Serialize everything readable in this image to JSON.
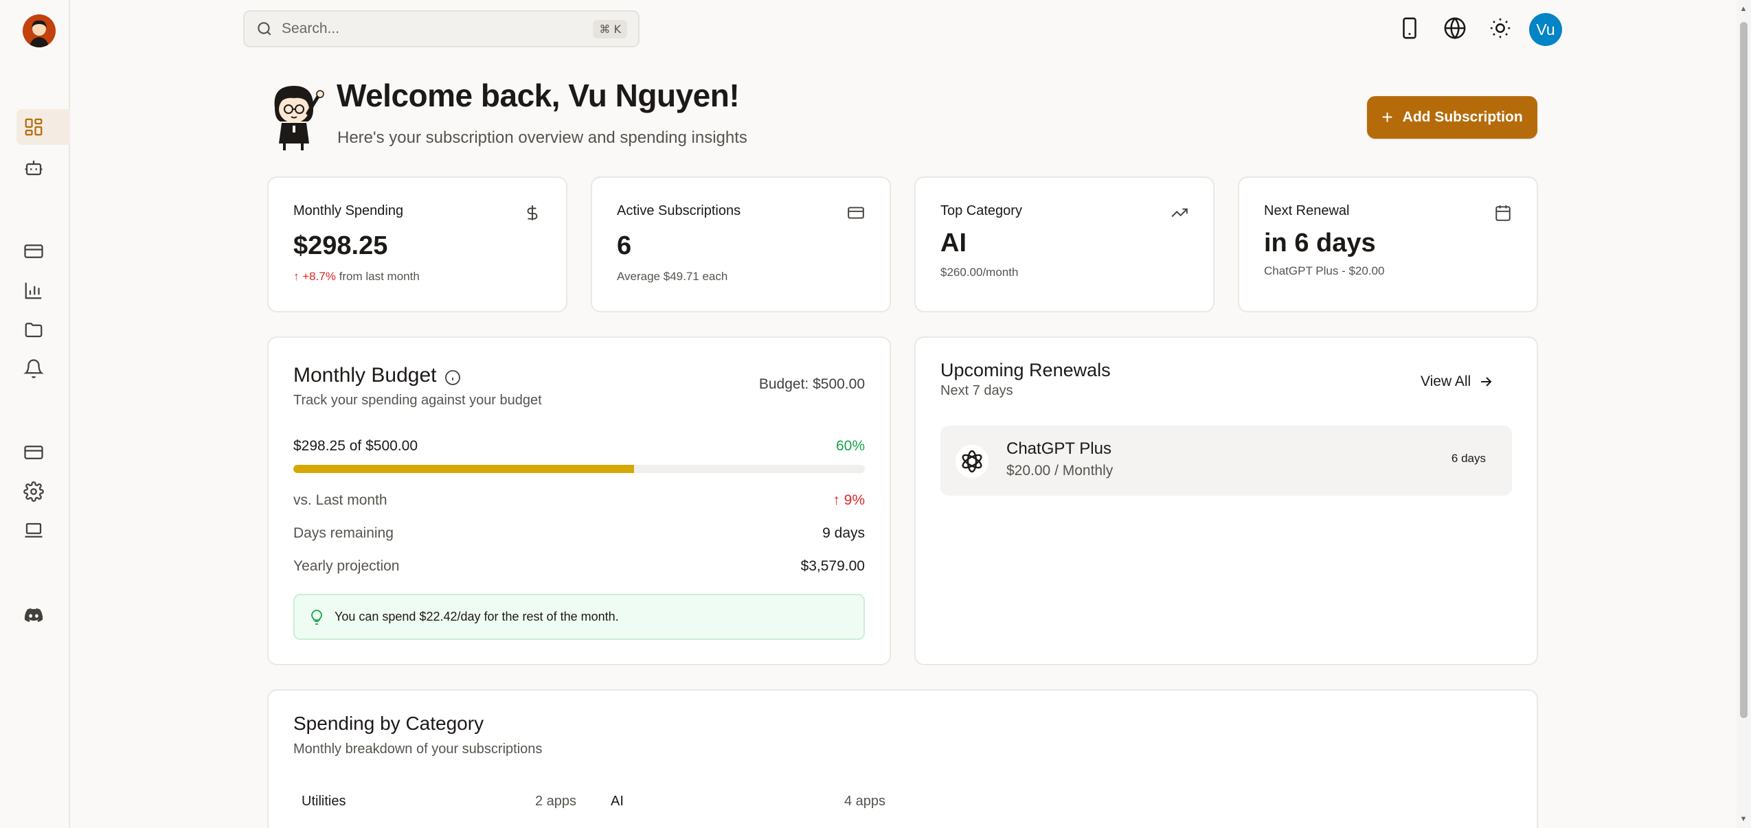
{
  "sidebar": {
    "items": [
      {
        "icon": "dashboard-icon",
        "active": true
      },
      {
        "icon": "bot-icon"
      },
      {
        "icon": "credit-card-icon"
      },
      {
        "icon": "bar-chart-icon"
      },
      {
        "icon": "folder-icon"
      },
      {
        "icon": "bell-icon"
      },
      {
        "icon": "wallet-icon"
      },
      {
        "icon": "gear-icon"
      },
      {
        "icon": "laptop-icon"
      },
      {
        "icon": "discord-icon"
      }
    ]
  },
  "topbar": {
    "search_placeholder": "Search...",
    "shortcut": "⌘ K",
    "icons": [
      "mobile-icon",
      "globe-icon",
      "sun-icon"
    ],
    "user_initials": "Vu"
  },
  "header": {
    "welcome": "Welcome back, Vu Nguyen!",
    "subtitle": "Here's your subscription overview and spending insights",
    "add_button": "Add Subscription"
  },
  "stats": [
    {
      "title": "Monthly Spending",
      "icon": "dollar-icon",
      "value": "$298.25",
      "change": "+8.7%",
      "sub": "from last month"
    },
    {
      "title": "Active Subscriptions",
      "icon": "credit-card-icon",
      "value": "6",
      "sub": "Average $49.71 each"
    },
    {
      "title": "Top Category",
      "icon": "trending-up-icon",
      "value": "AI",
      "sub": "$260.00/month"
    },
    {
      "title": "Next Renewal",
      "icon": "calendar-icon",
      "value": "in 6 days",
      "sub": "ChatGPT Plus - $20.00"
    }
  ],
  "budget": {
    "title": "Monthly Budget",
    "subtitle": "Track your spending against your budget",
    "budget_label": "Budget: $500.00",
    "progress_label": "$298.25 of $500.00",
    "progress_percent": "60%",
    "progress_fraction": 0.5965,
    "rows": [
      {
        "label": "vs. Last month",
        "value": "9%"
      },
      {
        "label": "Days remaining",
        "value": "9 days"
      },
      {
        "label": "Yearly projection",
        "value": "$3,579.00"
      }
    ],
    "tip": "You can spend $22.42/day for the rest of the month.",
    "colors": {
      "bar": "#d5a806",
      "positive": "#16a34a",
      "negative": "#dc2626"
    }
  },
  "renewals": {
    "title": "Upcoming Renewals",
    "subtitle": "Next 7 days",
    "view_all": "View All",
    "items": [
      {
        "name": "ChatGPT Plus",
        "price": "$20.00 / Monthly",
        "days": "6 days",
        "icon": "openai-icon"
      }
    ]
  },
  "categories": {
    "title": "Spending by Category",
    "subtitle": "Monthly breakdown of your subscriptions",
    "items": [
      {
        "name": "Utilities",
        "count": "2 apps"
      },
      {
        "name": "AI",
        "count": "4 apps"
      }
    ]
  },
  "accent": "#b66b0b"
}
